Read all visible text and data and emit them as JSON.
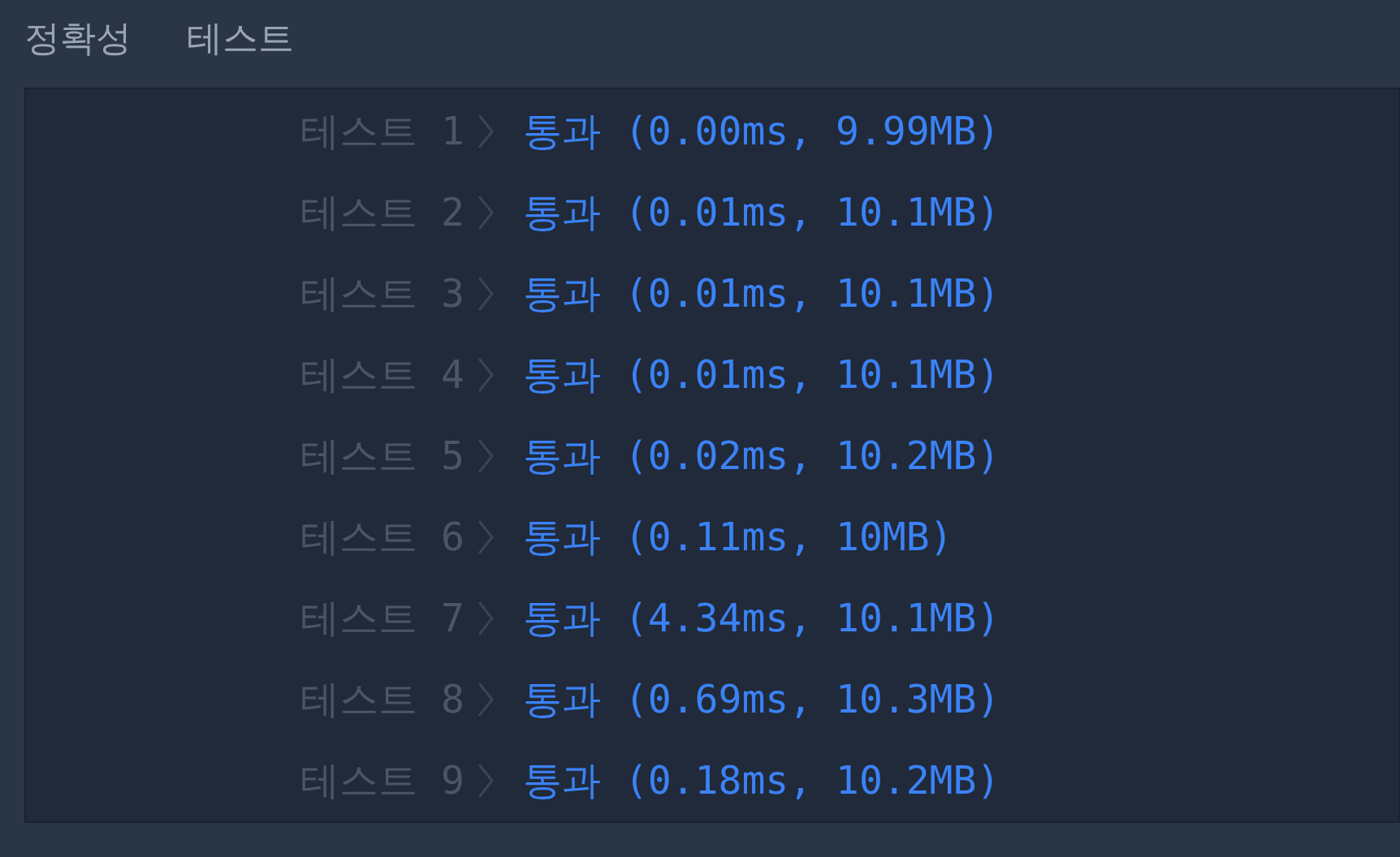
{
  "header": [
    "정확성",
    "테스트"
  ],
  "results": [
    {
      "label": "테스트 1",
      "result": "통과 (0.00ms, 9.99MB)"
    },
    {
      "label": "테스트 2",
      "result": "통과 (0.01ms, 10.1MB)"
    },
    {
      "label": "테스트 3",
      "result": "통과 (0.01ms, 10.1MB)"
    },
    {
      "label": "테스트 4",
      "result": "통과 (0.01ms, 10.1MB)"
    },
    {
      "label": "테스트 5",
      "result": "통과 (0.02ms, 10.2MB)"
    },
    {
      "label": "테스트 6",
      "result": "통과 (0.11ms, 10MB)"
    },
    {
      "label": "테스트 7",
      "result": "통과 (4.34ms, 10.1MB)"
    },
    {
      "label": "테스트 8",
      "result": "통과 (0.69ms, 10.3MB)"
    },
    {
      "label": "테스트 9",
      "result": "통과 (0.18ms, 10.2MB)"
    }
  ]
}
